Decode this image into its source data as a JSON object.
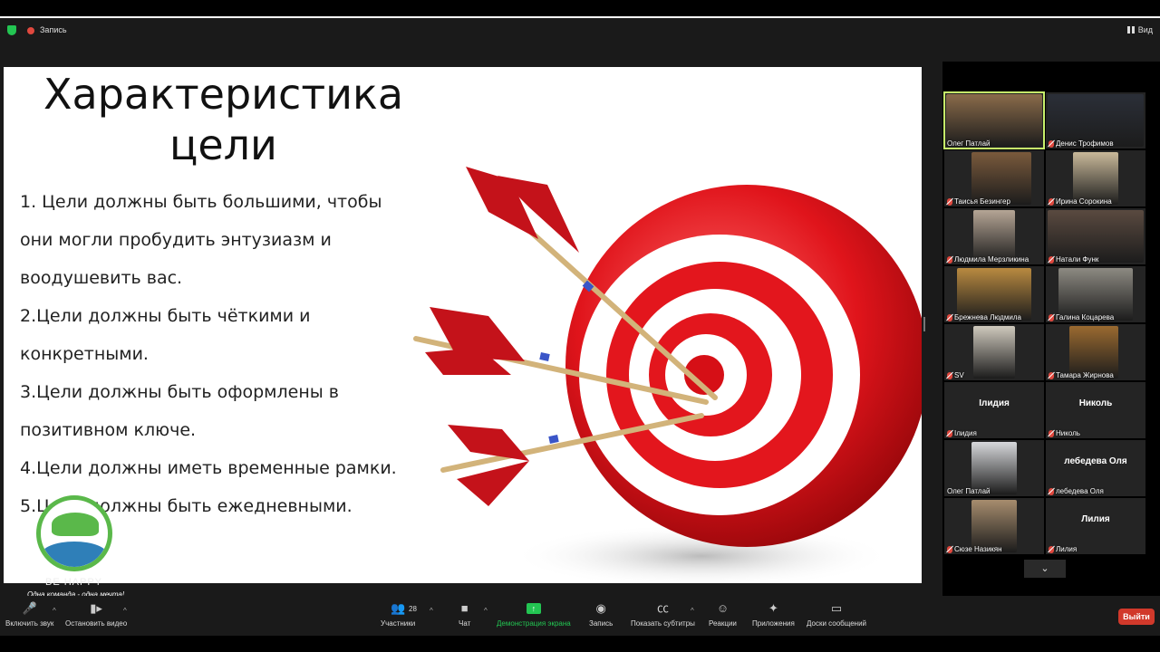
{
  "topbar": {
    "recording_label": "Запись",
    "view_label": "Вид"
  },
  "slide": {
    "title_line1": "Характеристика",
    "title_line2": "цели",
    "points": [
      "1. Цели должны быть большими, чтобы они могли пробудить энтузиазм и воодушевить вас.",
      "2.Цели должны быть чёткими и конкретными.",
      "3.Цели должны быть оформлены в позитивном ключе.",
      "4.Цели должны иметь временные рамки.",
      "5.Цели должны быть ежедневными."
    ],
    "logo_brand": "BE HAPPY",
    "logo_motto": "Одна команда - одна мечта!"
  },
  "participants": [
    {
      "name": "Олег Патлай",
      "muted": false,
      "active": true,
      "photo": "#8a6b4a"
    },
    {
      "name": "Денис Трофимов",
      "muted": true,
      "photo": "#2b2f38"
    },
    {
      "name": "Таисья Безингер",
      "muted": true,
      "photo": "#7a5a3c"
    },
    {
      "name": "Ирина Сорокина",
      "muted": true,
      "photo": "#c9b99a"
    },
    {
      "name": "Людмила Мерзликина",
      "muted": true,
      "photo": "#b5a595"
    },
    {
      "name": "Натали Функ",
      "muted": true,
      "photo": "#5a4a40"
    },
    {
      "name": "Брежнева Людмила",
      "muted": true,
      "photo": "#b98a40"
    },
    {
      "name": "Галина Коцарева",
      "muted": true,
      "photo": "#8d8a82"
    },
    {
      "name": "SV",
      "muted": true,
      "photo": "#cfc9bd"
    },
    {
      "name": "Тамара Жирнова",
      "muted": true,
      "photo": "#9a6a30"
    },
    {
      "name": "Iлидия",
      "muted": true,
      "center": "Iлидия"
    },
    {
      "name": "Николь",
      "muted": true,
      "center": "Николь"
    },
    {
      "name": "Олег Патлай",
      "muted": false,
      "photo": "#d7d8db"
    },
    {
      "name": "лебедева Оля",
      "muted": true,
      "center": "лебедева Оля"
    },
    {
      "name": "Сюзе Назикян",
      "muted": true,
      "photo": "#a78d6e"
    },
    {
      "name": "Лилия",
      "muted": true,
      "center": "Лилия"
    }
  ],
  "toolbar": {
    "unmute": "Включить звук",
    "start_video": "Остановить видео",
    "participants": "Участники",
    "participants_count": "28",
    "chat": "Чат",
    "share_screen": "Демонстрация экрана",
    "record": "Запись",
    "captions": "Показать субтитры",
    "reactions": "Реакции",
    "apps": "Приложения",
    "whiteboards": "Доски сообщений",
    "leave": "Выйти"
  },
  "colors": {
    "accent_green": "#23c552",
    "active_speaker": "#c7f06a",
    "leave_red": "#d1392b"
  }
}
